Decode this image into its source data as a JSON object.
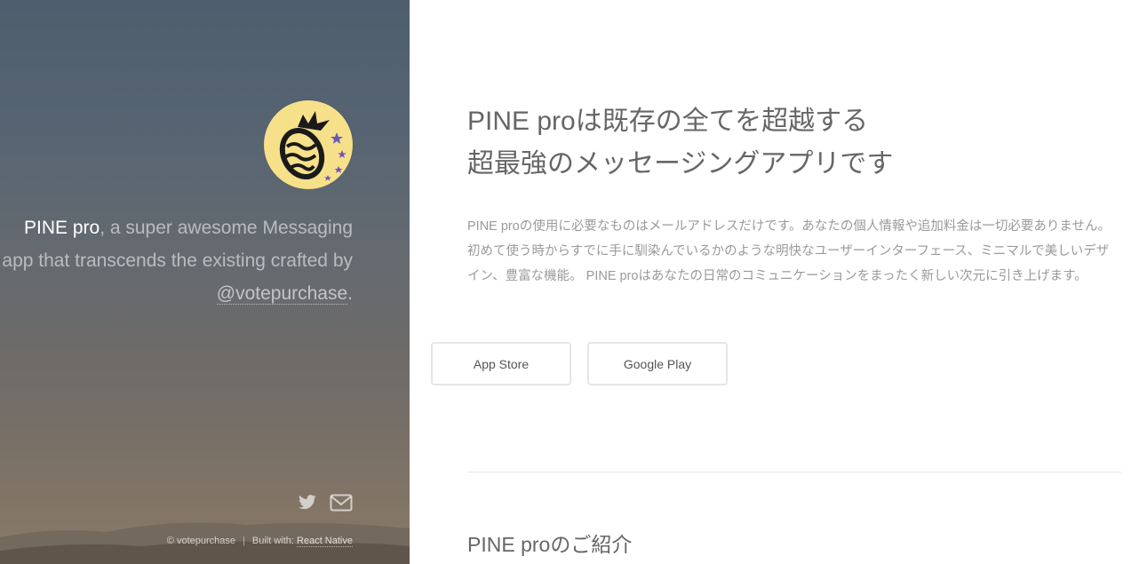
{
  "sidebar": {
    "brand": "PINE pro",
    "tagline_part1": ", a super awesome Messaging app that transcends the existing crafted by ",
    "author": "@votepurchase",
    "tagline_end": ".",
    "social": {
      "twitter_icon": "twitter-icon",
      "mail_icon": "mail-icon"
    },
    "footer": {
      "copyright": "© votepurchase",
      "built_with_label": "Built with: ",
      "built_with_link": "React Native"
    }
  },
  "main": {
    "headline_line1": "PINE proは既存の全てを超越する",
    "headline_line2": "超最強のメッセージングアプリです",
    "description": "PINE proの使用に必要なものはメールアドレスだけです。あなたの個人情報や追加料金は一切必要ありません。 初めて使う時からすでに手に馴染んでいるかのような明快なユーザーインターフェース、ミニマルで美しいデザイン、豊富な機能。 PINE proはあなたの日常のコミュニケーションをまったく新しい次元に引き上げます。",
    "buttons": {
      "app_store": "App Store",
      "google_play": "Google Play"
    },
    "section_title": "PINE proのご紹介"
  },
  "colors": {
    "logo_bg": "#f7e08a",
    "sidebar_top": "#4e5e6d",
    "sidebar_bottom": "#8a7a68",
    "text_gray": "#666666"
  }
}
